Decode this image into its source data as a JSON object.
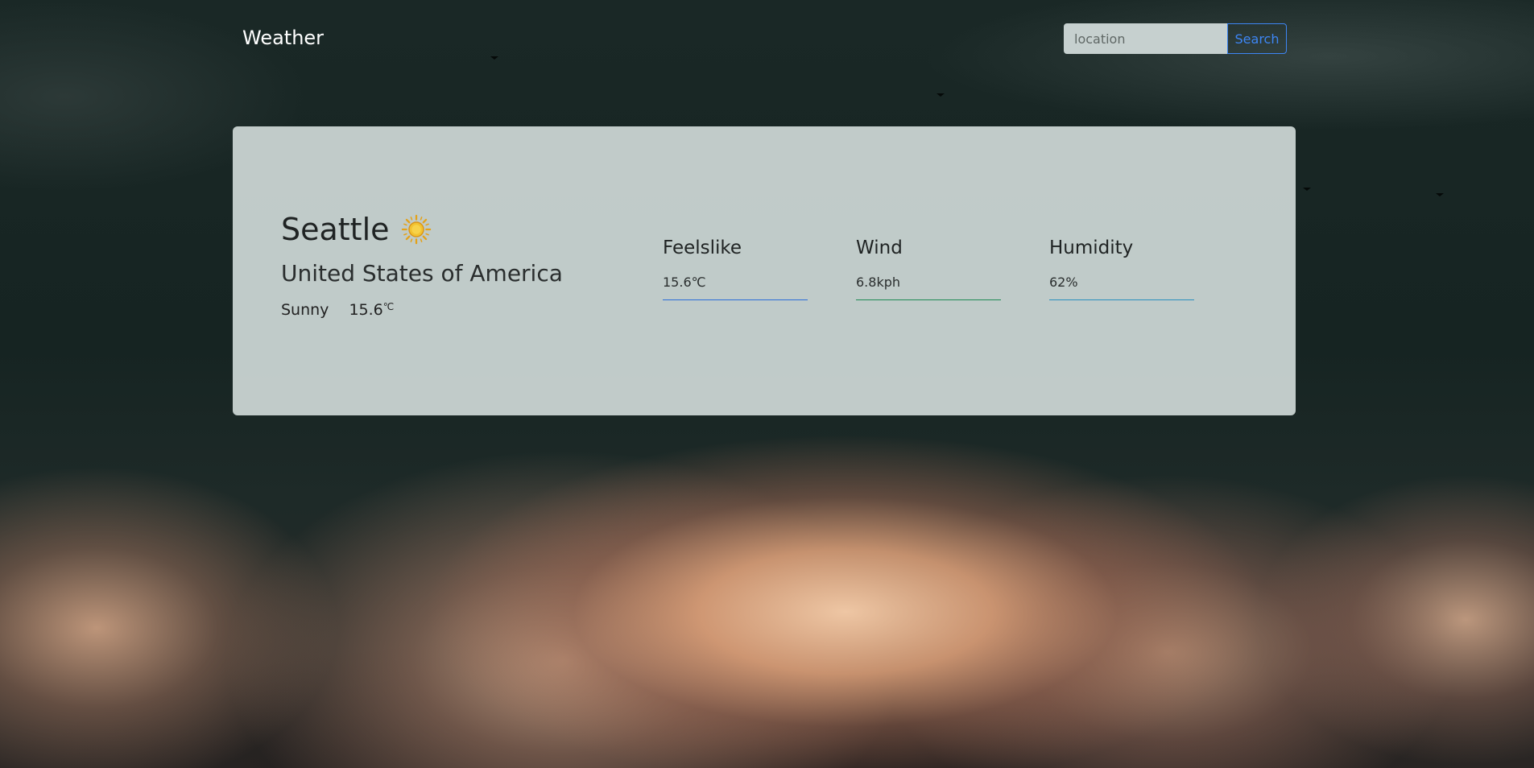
{
  "brand": "Weather",
  "search": {
    "placeholder": "location",
    "button_label": "Search"
  },
  "current": {
    "city": "Seattle",
    "country": "United States of America",
    "condition": "Sunny",
    "temp_value": "15.6",
    "temp_unit": "℃",
    "icon": "sun-icon"
  },
  "stats": [
    {
      "title": "Feelslike",
      "value": "15.6℃",
      "bar_color": "#2b6ed8"
    },
    {
      "title": "Wind",
      "value": "6.8kph",
      "bar_color": "#1f8a55"
    },
    {
      "title": "Humidity",
      "value": "62%",
      "bar_color": "#2a8fbe"
    }
  ],
  "colors": {
    "accent": "#3d86f5",
    "card_bg": "#c8d2d0",
    "sun": "#e3a21a"
  }
}
